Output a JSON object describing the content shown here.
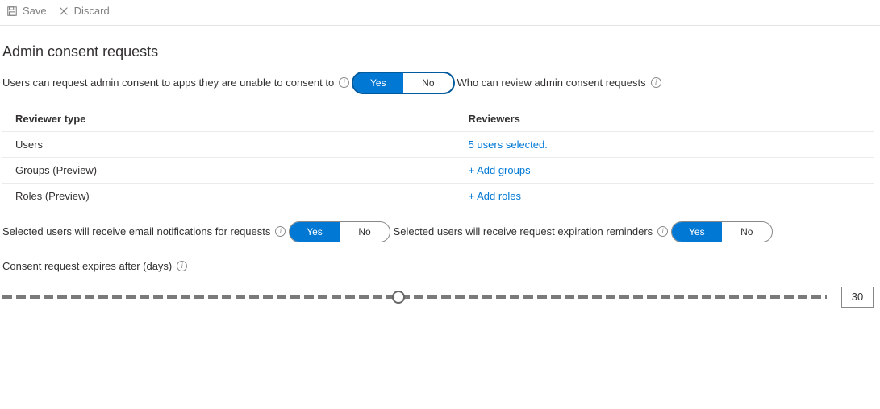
{
  "toolbar": {
    "save_label": "Save",
    "discard_label": "Discard"
  },
  "section": {
    "title": "Admin consent requests",
    "request_label": "Users can request admin consent to apps they are unable to consent to",
    "toggle_yes": "Yes",
    "toggle_no": "No",
    "review_label": "Who can review admin consent requests",
    "table": {
      "col1": "Reviewer type",
      "col2": "Reviewers",
      "rows": [
        {
          "type": "Users",
          "reviewers": "5 users selected."
        },
        {
          "type": "Groups (Preview)",
          "reviewers": "+ Add groups"
        },
        {
          "type": "Roles (Preview)",
          "reviewers": "+ Add roles"
        }
      ]
    },
    "email_label": "Selected users will receive email notifications for requests",
    "reminder_label": "Selected users will receive request expiration reminders",
    "expires_label": "Consent request expires after (days)",
    "slider": {
      "min": 0,
      "max": 60,
      "value": 30,
      "percent": 48
    }
  }
}
